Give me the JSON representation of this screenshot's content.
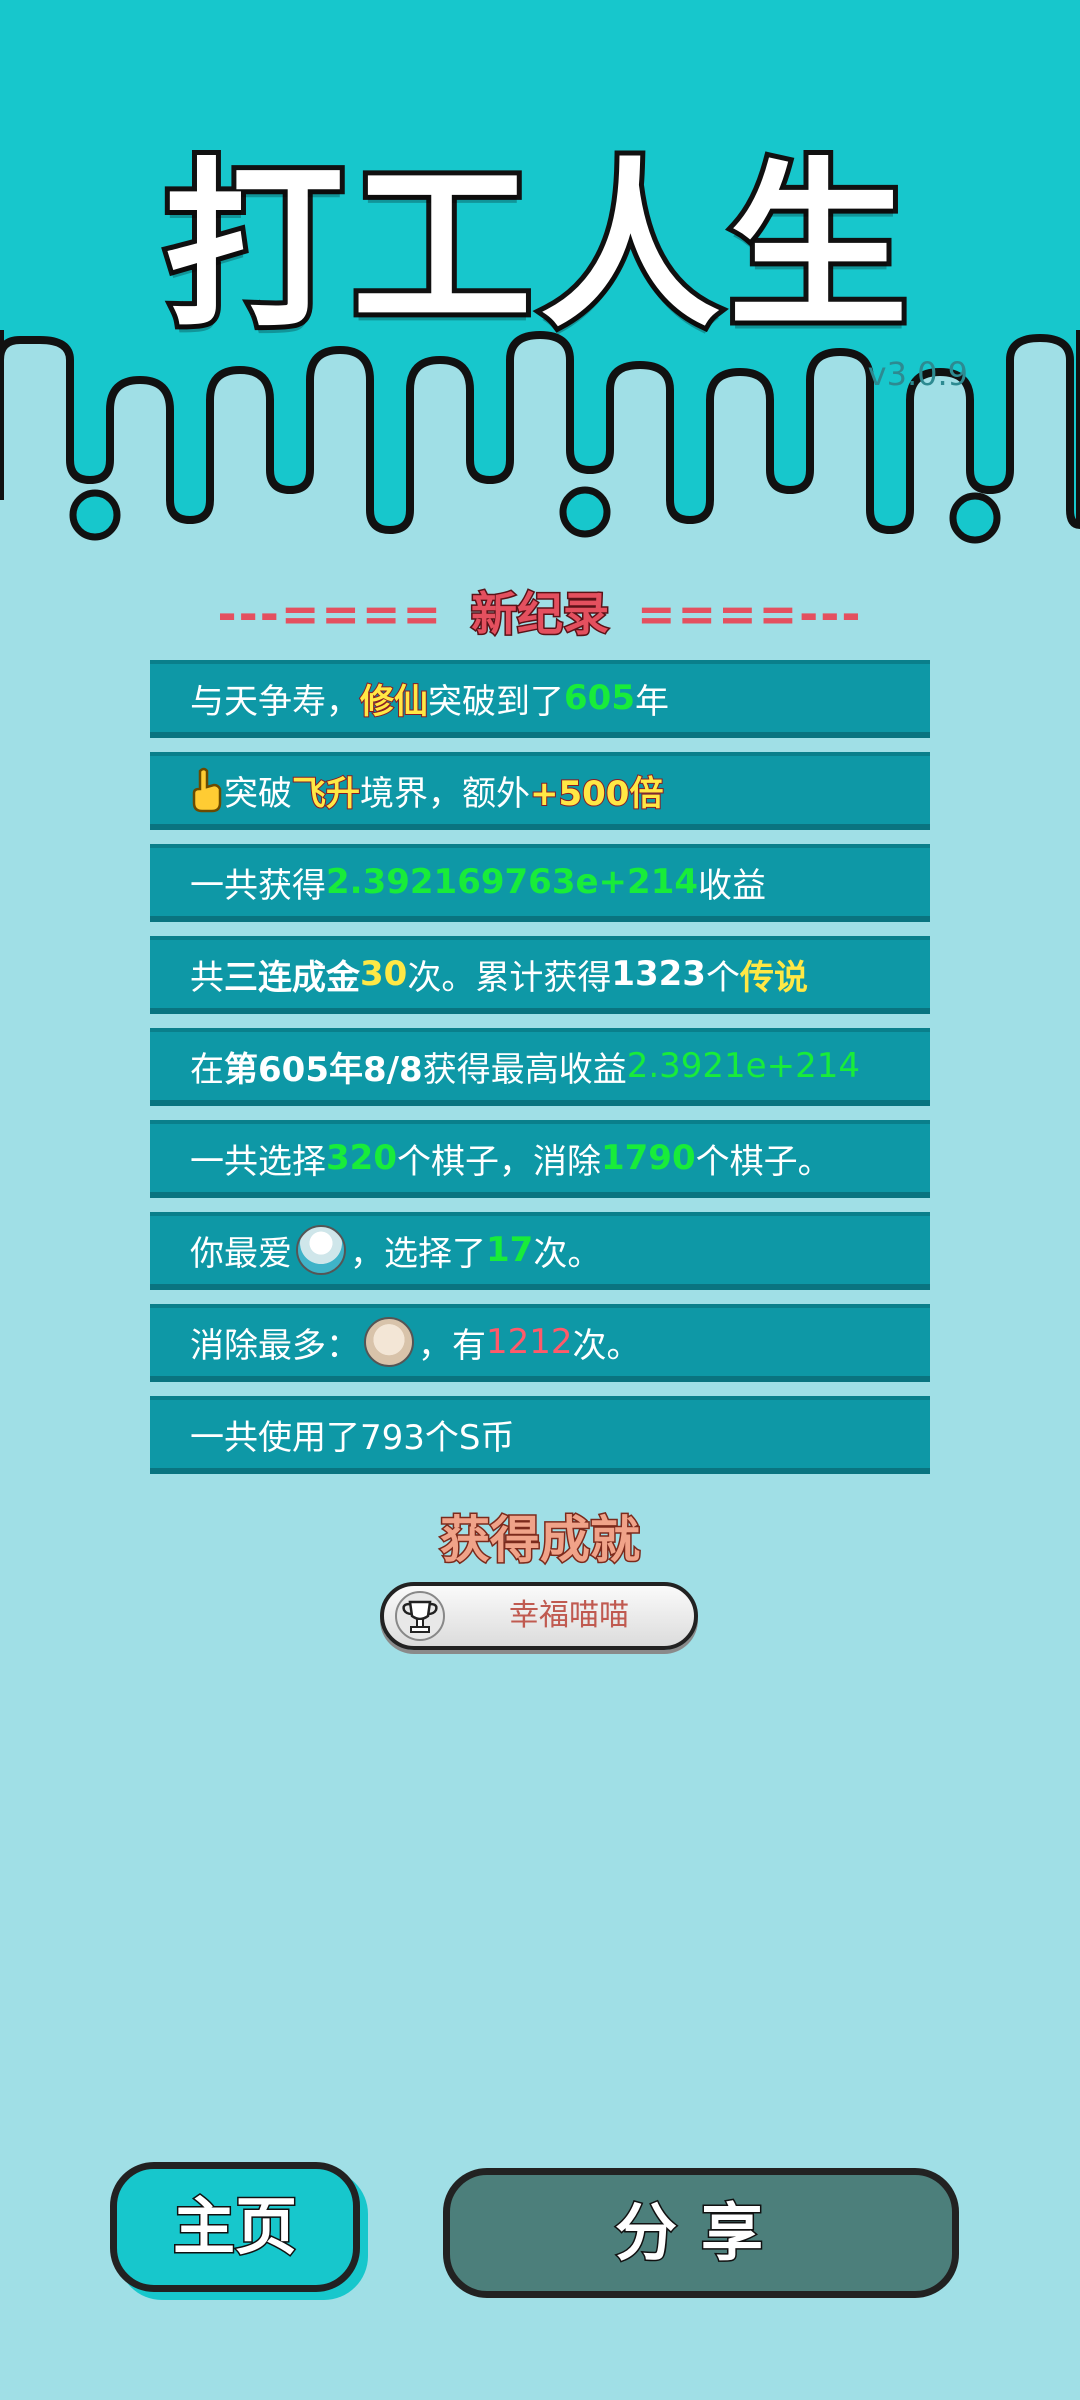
{
  "app": {
    "title": "打工人生",
    "version": "v3.0.9"
  },
  "record_header": {
    "left_dash": "---====",
    "label": "新纪录",
    "right_dash": "====---"
  },
  "stats": {
    "r1": {
      "a": "与天争寿，",
      "b": "修仙",
      "c": "突破到了",
      "d": "605",
      "e": "年"
    },
    "r2": {
      "a": "突破",
      "b": "飞升",
      "c": "境界，额外",
      "d": "+500倍"
    },
    "r3": {
      "a": "一共获得",
      "b": "2.392169763e+214",
      "c": "收益"
    },
    "r4": {
      "a": "共",
      "b": "三连成金",
      "c": "30",
      "d": "次。累计获得",
      "e": "1323",
      "f": "个",
      "g": "传说"
    },
    "r5": {
      "a": "在 ",
      "b": "第605年8/8",
      "c": " 获得最高收益",
      "d": "2.3921e+214"
    },
    "r6": {
      "a": "一共选择",
      "b": "320",
      "c": "个棋子，消除",
      "d": "1790",
      "e": "个棋子。"
    },
    "r7": {
      "a": "你最爱",
      "b": "，选择了",
      "c": "17",
      "d": "次。"
    },
    "r8": {
      "a": "消除最多：",
      "b": "，有",
      "c": "1212",
      "d": "次。"
    },
    "r9": {
      "a": "一共使用了793个S币"
    }
  },
  "achievement": {
    "title": "获得成就",
    "badge_name": "幸福喵喵"
  },
  "buttons": {
    "home": "主页",
    "share": "分享"
  },
  "colors": {
    "top_band": "#17c7cc",
    "background": "#a0dfe6",
    "row": "#0e98a6",
    "green": "#18ec3a",
    "yellow": "#ffe845",
    "red": "#ff5a6a"
  }
}
